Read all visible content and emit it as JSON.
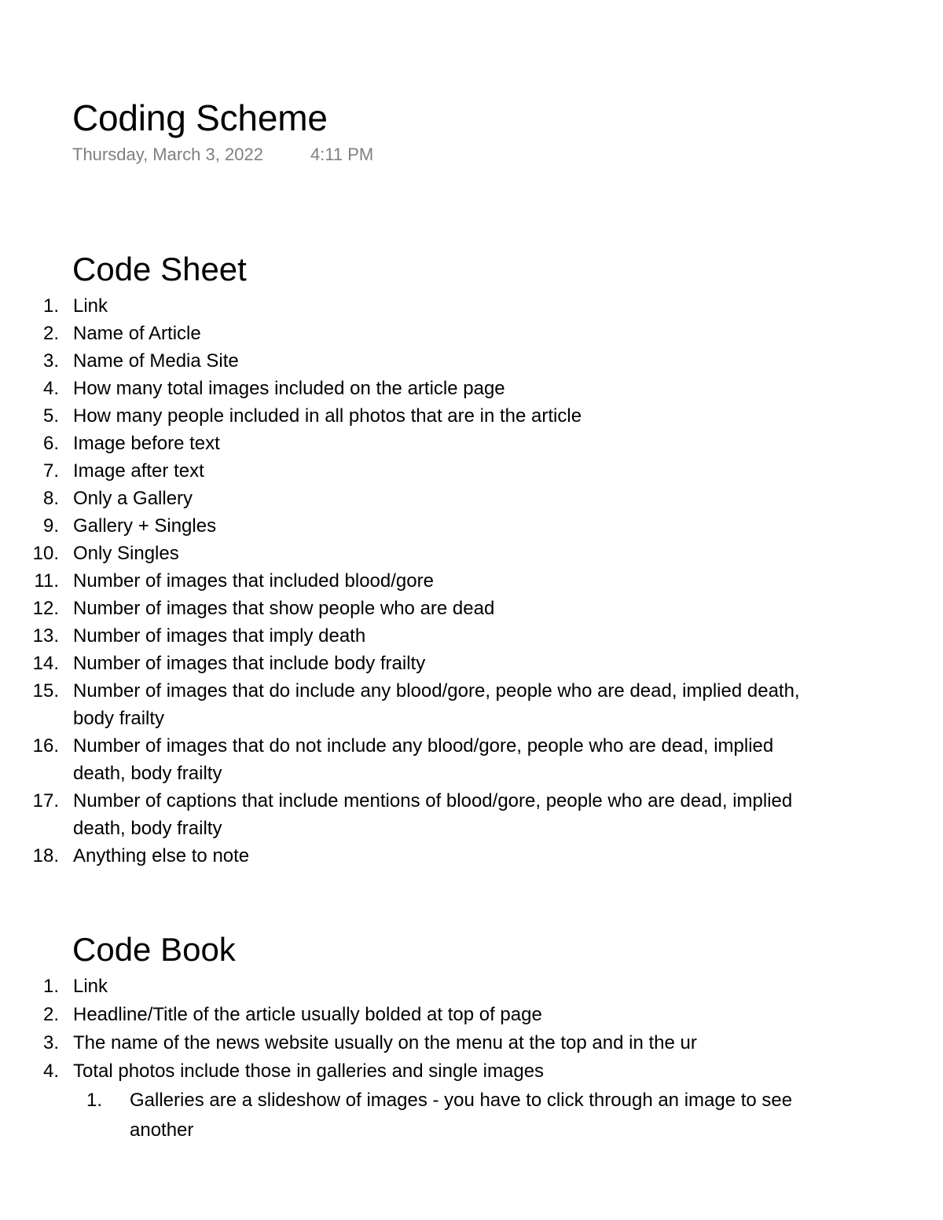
{
  "document": {
    "title": "Coding Scheme",
    "date": "Thursday, March 3, 2022",
    "time": "4:11 PM"
  },
  "sections": [
    {
      "heading": "Code Sheet",
      "items": [
        {
          "number": "1.",
          "text": "Link"
        },
        {
          "number": "2.",
          "text": "Name of Article"
        },
        {
          "number": "3.",
          "text": "Name of Media Site"
        },
        {
          "number": "4.",
          "text": "How many total images included on the article page"
        },
        {
          "number": "5.",
          "text": "How many people included in all photos that are in the article"
        },
        {
          "number": "6.",
          "text": "Image before text"
        },
        {
          "number": "7.",
          "text": "Image after text"
        },
        {
          "number": "8.",
          "text": "Only a Gallery"
        },
        {
          "number": "9.",
          "text": "Gallery + Singles"
        },
        {
          "number": "10.",
          "text": "Only Singles"
        },
        {
          "number": "11.",
          "text": "Number of images that included blood/gore"
        },
        {
          "number": "12.",
          "text": "Number of images that show people who are dead"
        },
        {
          "number": "13.",
          "text": "Number of images that imply death"
        },
        {
          "number": "14.",
          "text": "Number of images that include body frailty"
        },
        {
          "number": "15.",
          "text": "Number of images that do include any blood/gore, people who are dead, implied death, body frailty"
        },
        {
          "number": "16.",
          "text": "Number of images that do not include any blood/gore, people who are dead, implied death, body frailty"
        },
        {
          "number": "17.",
          "text": "Number of captions that include mentions of blood/gore, people who are dead, implied death, body frailty"
        },
        {
          "number": "18.",
          "text": "Anything else to note"
        }
      ]
    },
    {
      "heading": "Code Book",
      "items": [
        {
          "number": "1.",
          "text": "Link"
        },
        {
          "number": "2.",
          "text": "Headline/Title of the article usually bolded at top of page"
        },
        {
          "number": "3.",
          "text": "The name of the news website usually on the menu at the top and in the ur"
        },
        {
          "number": "4.",
          "text": "Total photos include those in galleries and single images",
          "subitems": [
            {
              "number": "1.",
              "text": "Galleries are a slideshow of images - you have to click through an image to see another"
            }
          ]
        }
      ]
    }
  ]
}
